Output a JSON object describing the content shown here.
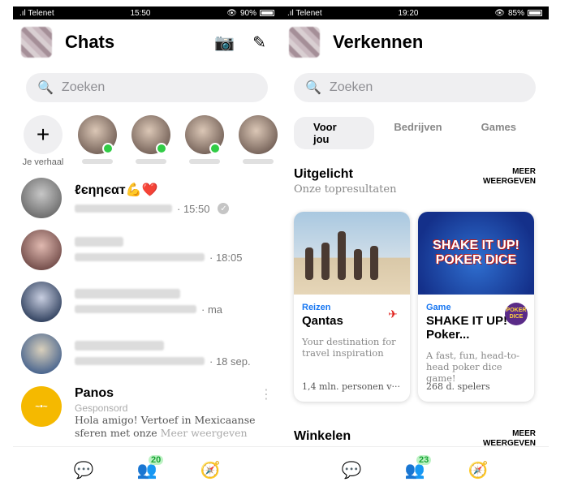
{
  "left": {
    "status": {
      "carrier": ".ıl Telenet",
      "time": "15:50",
      "battery": "90%"
    },
    "title": "Chats",
    "search_placeholder": "Zoeken",
    "my_story_label": "Je verhaal",
    "chats": [
      {
        "name": "ℓєηηєαт💪❤️",
        "time": "· 15:50",
        "read": true
      },
      {
        "name": "",
        "time": "· 18:05"
      },
      {
        "name": "",
        "time": "· ma"
      },
      {
        "name": "",
        "time": "· 18 sep."
      }
    ],
    "ad": {
      "name": "Panos",
      "sponsored": "Gesponsord",
      "text": "Hola amigo! Vertoef in Mexicaanse sferen met onze",
      "more": "Meer weergeven"
    },
    "tabbar": {
      "people_badge": "20"
    }
  },
  "right": {
    "status": {
      "carrier": ".ıl Telenet",
      "time": "19:20",
      "battery": "85%"
    },
    "title": "Verkennen",
    "search_placeholder": "Zoeken",
    "tabs": [
      "Voor jou",
      "Bedrijven",
      "Games"
    ],
    "featured": {
      "title": "Uitgelicht",
      "subtitle": "Onze topresultaten",
      "more": "MEER WEERGEVEN"
    },
    "cards": [
      {
        "category": "Reizen",
        "title": "Qantas",
        "desc": "Your destination for travel inspiration",
        "foot": "1,4 mln. personen v···"
      },
      {
        "category": "Game",
        "title": "SHAKE IT UP! Poker...",
        "desc": "A fast, fun, head-to-head poker dice game!",
        "foot": "268 d. spelers",
        "image_text": "SHAKE IT UP! POKER DICE"
      }
    ],
    "shop": {
      "title": "Winkelen",
      "more": "MEER WEERGEVEN"
    },
    "tabbar": {
      "people_badge": "23"
    }
  }
}
